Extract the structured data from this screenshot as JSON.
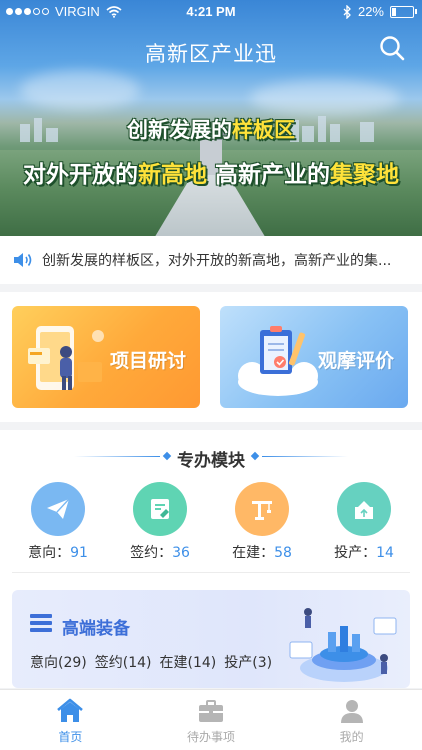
{
  "status_bar": {
    "carrier": "VIRGIN",
    "time": "4:21 PM",
    "battery": "22%",
    "battery_level": 0.22,
    "signal_bars_filled": 3,
    "signal_bars_total": 5
  },
  "header": {
    "title": "高新区产业迅",
    "search_icon": "search-icon"
  },
  "banner": {
    "line1_prefix": "创新发展的",
    "line1_highlight": "样板区",
    "line2_part1": "对外开放的",
    "line2_highlight1": "新高地",
    "line2_part2": "  高新产业的",
    "line2_highlight2": "集聚地"
  },
  "notice": {
    "icon": "speaker-icon",
    "text": "创新发展的样板区，对外开放的新高地，高新产业的集..."
  },
  "cards": [
    {
      "label": "项目研讨",
      "icon": "project-discussion-icon"
    },
    {
      "label": "观摩评价",
      "icon": "observation-review-icon"
    }
  ],
  "module": {
    "title": "专办模块",
    "stats": [
      {
        "label": "意向：",
        "value": "91",
        "icon": "paper-plane-icon",
        "color": "#7ab8f2"
      },
      {
        "label": "签约：",
        "value": "36",
        "icon": "contract-icon",
        "color": "#5fd4b3"
      },
      {
        "label": "在建：",
        "value": "58",
        "icon": "crane-icon",
        "color": "#ffb866"
      },
      {
        "label": "投产：",
        "value": "14",
        "icon": "production-icon",
        "color": "#66d1c0"
      }
    ],
    "industry": {
      "title": "高端装备",
      "icon": "equipment-icon",
      "counts": [
        "意向(29)",
        "签约(14)",
        "在建(14)",
        "投产(3)"
      ]
    }
  },
  "tabbar": {
    "tabs": [
      {
        "label": "首页",
        "icon": "home-icon",
        "active": true
      },
      {
        "label": "待办事项",
        "icon": "briefcase-icon",
        "active": false
      },
      {
        "label": "我的",
        "icon": "user-icon",
        "active": false
      }
    ]
  },
  "colors": {
    "accent": "#3d8fe8",
    "highlight_text": "#ffe23a",
    "card_orange": "#ffa93a",
    "card_blue": "#88c1f4"
  }
}
